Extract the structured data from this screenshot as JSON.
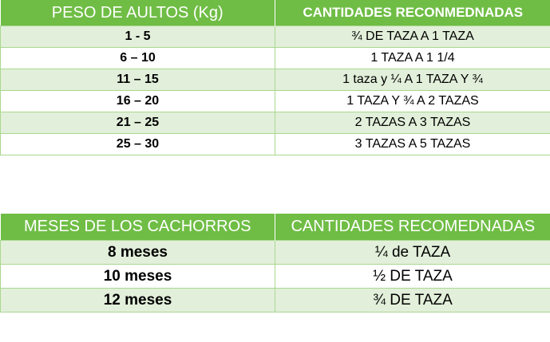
{
  "adult_table": {
    "headers": [
      "PESO DE AULTOS (Kg)",
      "CANTIDADES RECONMEDNADAS"
    ],
    "rows": [
      [
        "1 - 5",
        "¾ DE TAZA A 1 TAZA"
      ],
      [
        "6 – 10",
        "1 TAZA A 1 1/4"
      ],
      [
        "11 – 15",
        "1 taza y ¼ A 1 TAZA Y ¾"
      ],
      [
        "16 – 20",
        "1 TAZA Y ¾ A 2 TAZAS"
      ],
      [
        "21 – 25",
        "2 TAZAS A 3 TAZAS"
      ],
      [
        "25 – 30",
        "3 TAZAS A 5 TAZAS"
      ]
    ]
  },
  "puppy_table": {
    "headers": [
      "MESES DE LOS CACHORROS",
      "CANTIDADES RECOMEDNADAS"
    ],
    "rows": [
      [
        "8 meses",
        "¼ de TAZA"
      ],
      [
        "10 meses",
        "½ DE TAZA"
      ],
      [
        "12 meses",
        "¾ DE TAZA"
      ]
    ]
  },
  "colors": {
    "header_green": "#6fbd45",
    "row_alt_green": "#e2efda",
    "border_green": "#a9d88f"
  }
}
